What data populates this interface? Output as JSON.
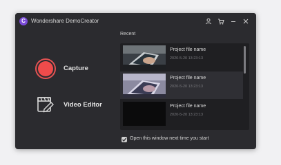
{
  "app": {
    "logo_letter": "C",
    "title": "Wondershare DemoCreator"
  },
  "titlebar_icons": [
    "account-icon",
    "cart-icon",
    "minimize-icon",
    "close-icon"
  ],
  "actions": {
    "capture_label": "Capture",
    "editor_label": "Video Editor"
  },
  "recent": {
    "title": "Recent",
    "files": [
      {
        "name": "Project file name",
        "date": "2020-5-20 13:23:13"
      },
      {
        "name": "Project file name",
        "date": "2020-5-20 13:23:13"
      },
      {
        "name": "Project file name",
        "date": "2020-5-20 13:23:13"
      }
    ],
    "selected_index": 1
  },
  "options": {
    "open_on_start_label": "Open this window next time you start",
    "open_on_start_checked": true
  },
  "colors": {
    "window_bg": "#2b2b2f",
    "accent_red": "#ef4b4b",
    "logo_purple": "#7b4bd8"
  }
}
